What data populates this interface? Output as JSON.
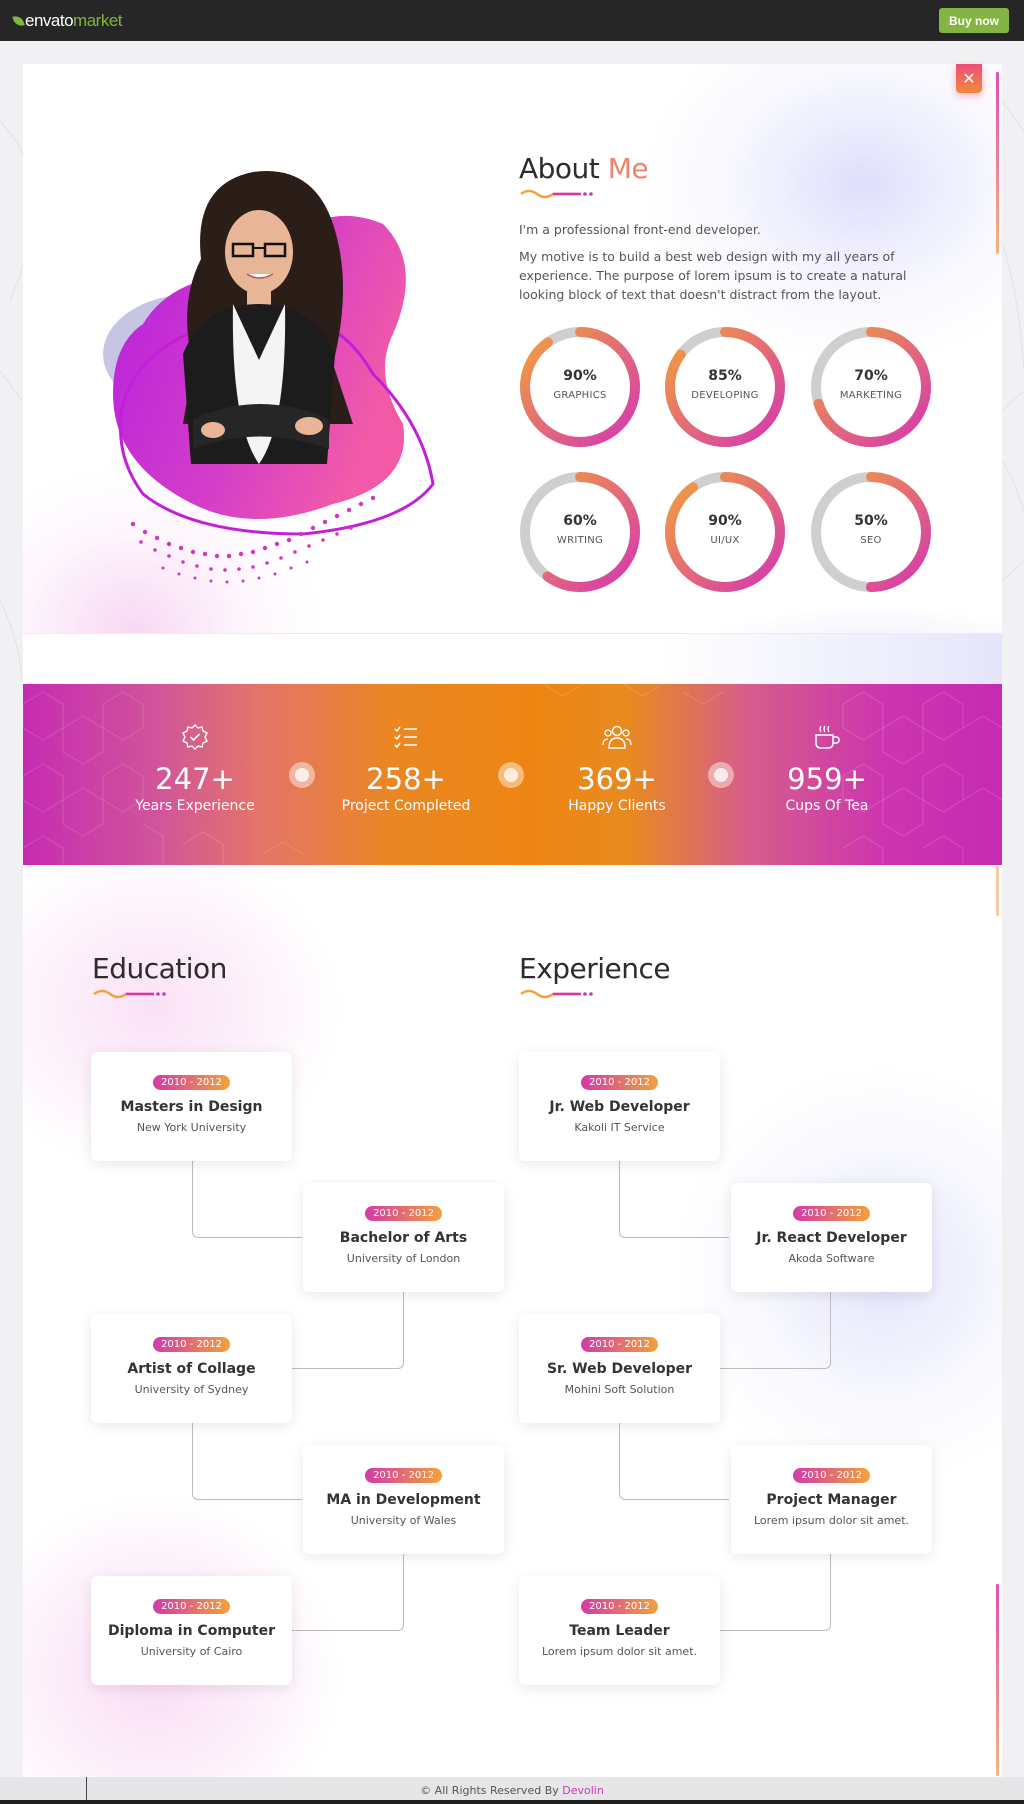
{
  "topbar": {
    "logo_text_1": "envato",
    "logo_text_2": "market",
    "buy_label": "Buy now"
  },
  "about": {
    "heading_1": "About",
    "heading_2": "Me",
    "intro": "I'm a professional front-end developer.",
    "body_lines": [
      "My motive is to build a best web design with my all years of",
      "experience. The purpose of lorem ipsum is to create a natural",
      "looking block of text that doesn't distract from the layout."
    ],
    "close_icon": "close-icon",
    "skills": [
      {
        "percent": "90%",
        "value": 90,
        "label": "GRAPHICS"
      },
      {
        "percent": "85%",
        "value": 85,
        "label": "DEVELOPING"
      },
      {
        "percent": "70%",
        "value": 70,
        "label": "MARKETING"
      },
      {
        "percent": "60%",
        "value": 60,
        "label": "WRITING"
      },
      {
        "percent": "90%",
        "value": 90,
        "label": "UI/UX"
      },
      {
        "percent": "50%",
        "value": 50,
        "label": "SEO"
      }
    ]
  },
  "stats": [
    {
      "icon": "badge-check-icon",
      "number": "247+",
      "label": "Years Experience"
    },
    {
      "icon": "checklist-icon",
      "number": "258+",
      "label": "Project Completed"
    },
    {
      "icon": "users-icon",
      "number": "369+",
      "label": "Happy Clients"
    },
    {
      "icon": "coffee-cup-icon",
      "number": "959+",
      "label": "Cups Of Tea"
    }
  ],
  "education": {
    "heading": "Education",
    "items": [
      {
        "years": "2010 - 2012",
        "title": "Masters in Design",
        "place": "New York University"
      },
      {
        "years": "2010 - 2012",
        "title": "Bachelor of Arts",
        "place": "University of London"
      },
      {
        "years": "2010 - 2012",
        "title": "Artist of Collage",
        "place": "University of Sydney"
      },
      {
        "years": "2010 - 2012",
        "title": "MA in Development",
        "place": "University of Wales"
      },
      {
        "years": "2010 - 2012",
        "title": "Diploma in Computer",
        "place": "University of Cairo"
      }
    ]
  },
  "experience": {
    "heading": "Experience",
    "items": [
      {
        "years": "2010 - 2012",
        "title": "Jr. Web Developer",
        "place": "Kakoli IT Service"
      },
      {
        "years": "2010 - 2012",
        "title": "Jr. React Developer",
        "place": "Akoda Software"
      },
      {
        "years": "2010 - 2012",
        "title": "Sr. Web Developer",
        "place": "Mohini Soft Solution"
      },
      {
        "years": "2010 - 2012",
        "title": "Project Manager",
        "place": "Lorem ipsum dolor sit amet."
      },
      {
        "years": "2010 - 2012",
        "title": "Team Leader",
        "place": "Lorem ipsum dolor sit amet."
      }
    ]
  },
  "footer": {
    "text": "© All Rights Reserved By",
    "brand": "Devolin"
  },
  "colors": {
    "accent_pink": "#d536b2",
    "accent_orange": "#f2a23a",
    "envato_green": "#82b541",
    "ring_track": "#cfcfcf"
  }
}
